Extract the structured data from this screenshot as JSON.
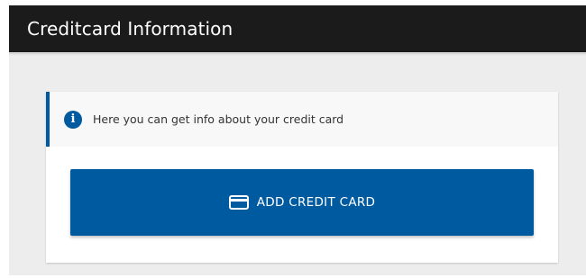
{
  "header": {
    "title": "Creditcard Information"
  },
  "info": {
    "icon": "info-icon",
    "text": "Here you can get info about your credit card"
  },
  "actions": {
    "add_card_label": "ADD CREDIT CARD",
    "add_card_icon": "credit-card-icon"
  },
  "colors": {
    "accent": "#005aa0",
    "header_bg": "#1b1b1b",
    "content_bg": "#ededed"
  }
}
